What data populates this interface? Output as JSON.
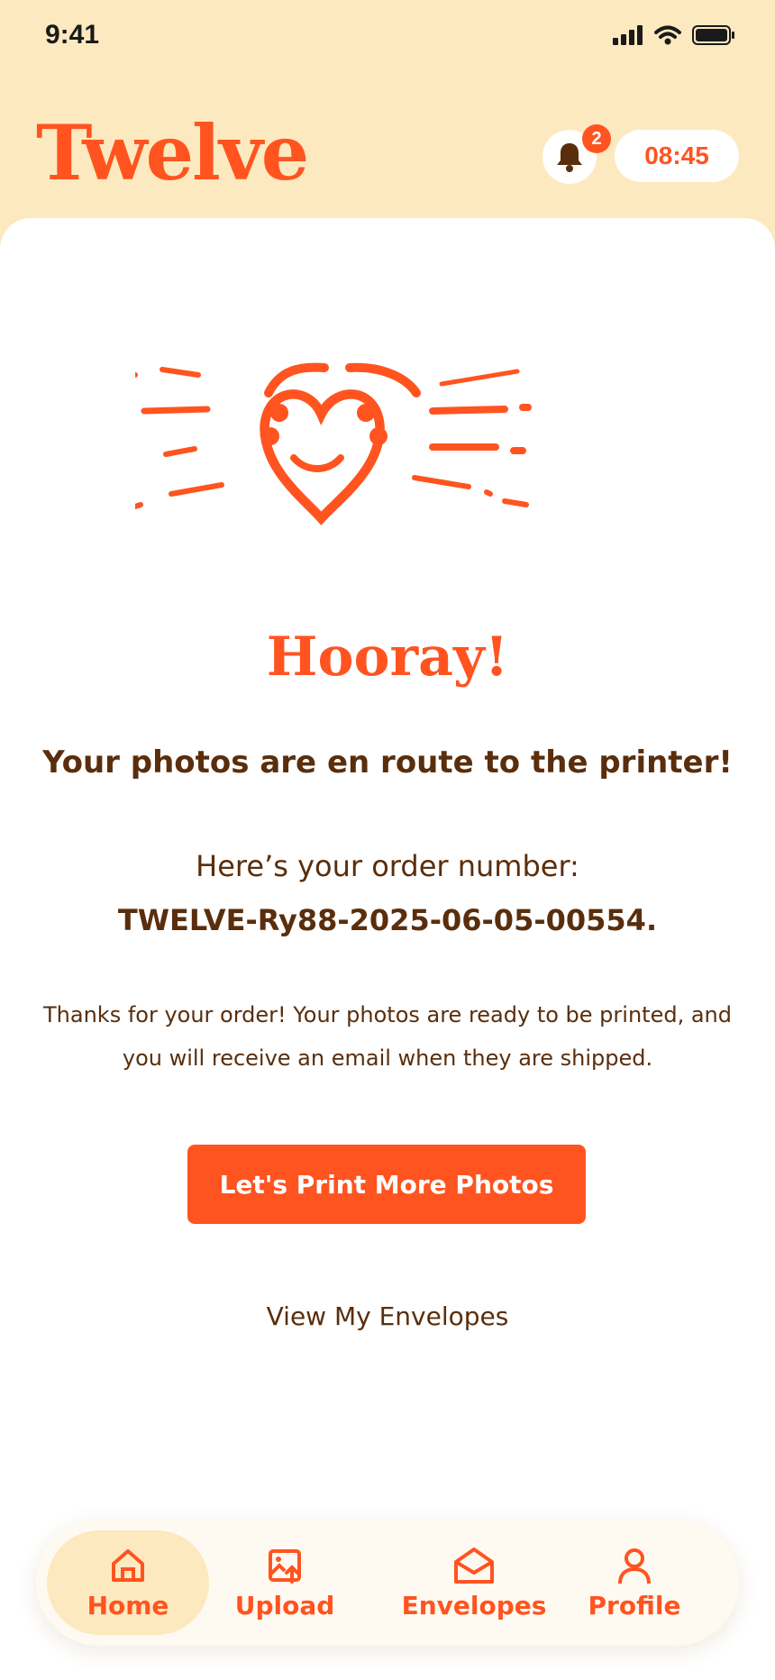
{
  "status_bar": {
    "time": "9:41"
  },
  "header": {
    "logo": "Twelve",
    "notification_count": "2",
    "timer": "08:45"
  },
  "confirmation": {
    "title": "Hooray!",
    "subtitle": "Your photos are en route to the printer!",
    "order_label": "Here’s your order number:",
    "order_number": "TWELVE-Ry88-2025-06-05-00554.",
    "message": "Thanks for your order! Your photos are ready to be printed, and you will receive an email when they are shipped.",
    "cta_label": "Let's Print More Photos",
    "envelopes_link": "View My Envelopes"
  },
  "tabbar": {
    "items": [
      {
        "label": "Home",
        "icon": "home-icon",
        "active": true
      },
      {
        "label": "Upload",
        "icon": "upload-image-icon",
        "active": false
      },
      {
        "label": "Envelopes",
        "icon": "envelope-icon",
        "active": false
      },
      {
        "label": "Profile",
        "icon": "person-icon",
        "active": false
      }
    ]
  },
  "colors": {
    "accent": "#ff5420",
    "text_brown": "#5a2e0c",
    "header_bg": "#fde9bf"
  }
}
